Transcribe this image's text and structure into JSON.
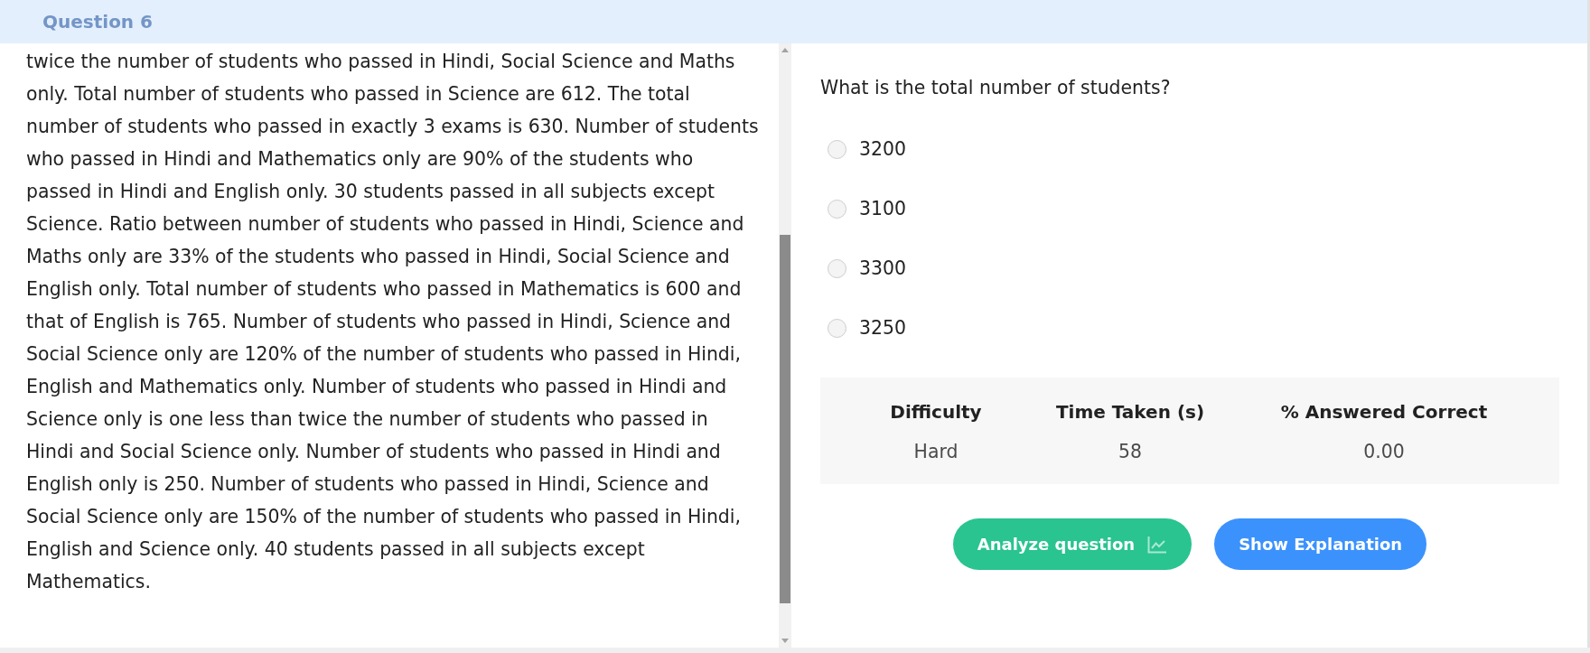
{
  "header": {
    "title": "Question 6"
  },
  "passage": {
    "text": "twice the number of students who passed in Hindi, Social Science and Maths only. Total number of students who passed in Science are 612. The total number of students who passed in exactly 3 exams is 630. Number of students who passed in Hindi and Mathematics only are 90% of the students who passed in Hindi and English only. 30 students passed in all subjects except Science. Ratio between number of students who passed in Hindi, Science and Maths only are 33% of the students who passed in Hindi, Social Science and English only. Total number of students who passed in Mathematics is 600 and that of English is 765. Number of students who passed in Hindi, Science and Social Science only are 120% of the number of students who passed in Hindi, English and Mathematics only. Number of students who passed in Hindi and Science only is one less than twice the number of students who passed in Hindi and Social Science only. Number of students who passed in Hindi and English only is 250. Number of students who passed in Hindi, Science and Social Science only are 150% of the number of students who passed in Hindi, English and Science only. 40 students passed in all subjects except Mathematics."
  },
  "question": {
    "text": "What is the total number of students?",
    "options": [
      {
        "label": "3200",
        "selected": false
      },
      {
        "label": "3100",
        "selected": false
      },
      {
        "label": "3300",
        "selected": false
      },
      {
        "label": "3250",
        "selected": false
      }
    ]
  },
  "stats": {
    "columns": [
      {
        "heading": "Difficulty",
        "value": "Hard"
      },
      {
        "heading": "Time Taken (s)",
        "value": "58"
      },
      {
        "heading": "% Answered Correct",
        "value": "0.00"
      }
    ]
  },
  "buttons": [
    {
      "label": "Analyze question",
      "kind": "analyze"
    },
    {
      "label": "Show Explanation",
      "kind": "explanation"
    }
  ]
}
